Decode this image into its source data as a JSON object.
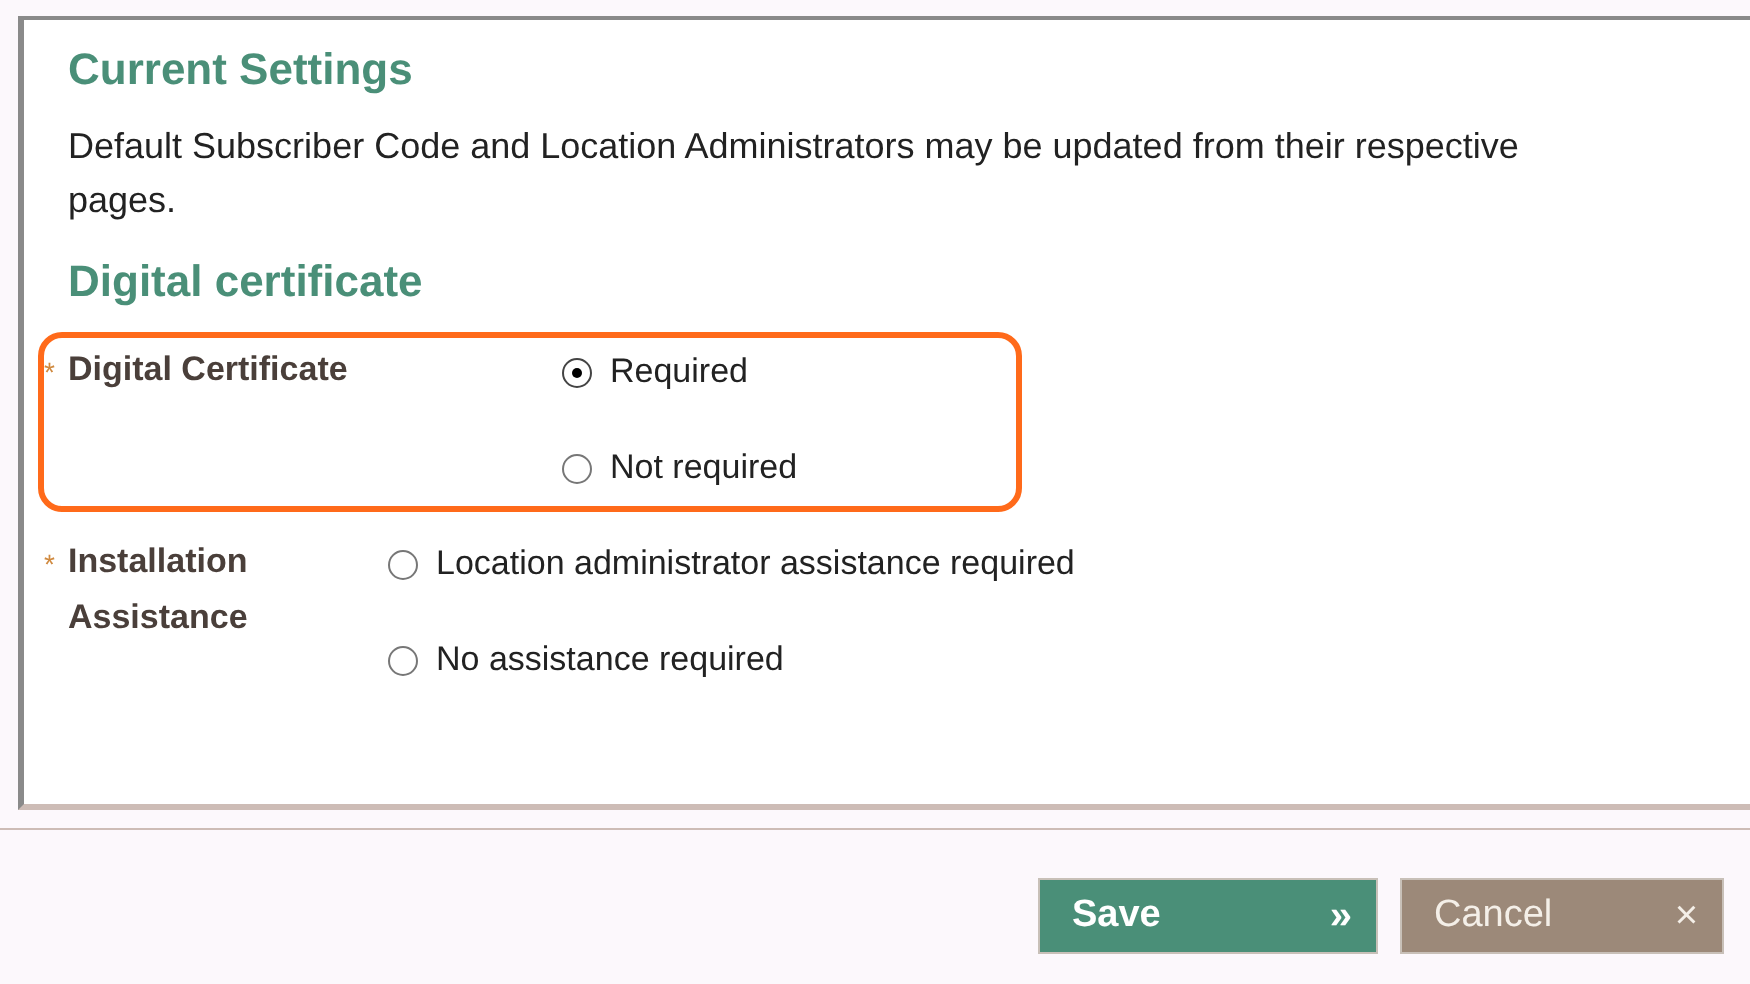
{
  "sections": [
    {
      "title": "Current Settings",
      "text": "Default Subscriber Code and Location Administrators may be updated from their respective pages."
    },
    {
      "title": "Digital certificate"
    }
  ],
  "fields": [
    {
      "label": "Digital Certificate",
      "required_mark": "*",
      "highlighted": true,
      "options": [
        {
          "label": "Required",
          "selected": true
        },
        {
          "label": "Not required",
          "selected": false
        }
      ]
    },
    {
      "label": "Installation Assistance",
      "required_mark": "*",
      "highlighted": false,
      "options": [
        {
          "label": "Location administrator assistance required",
          "selected": false
        },
        {
          "label": "No assistance required",
          "selected": false
        }
      ]
    }
  ],
  "buttons": [
    {
      "label": "Save",
      "icon": "»",
      "kind": "primary"
    },
    {
      "label": "Cancel",
      "icon": "×",
      "kind": "secondary"
    }
  ]
}
